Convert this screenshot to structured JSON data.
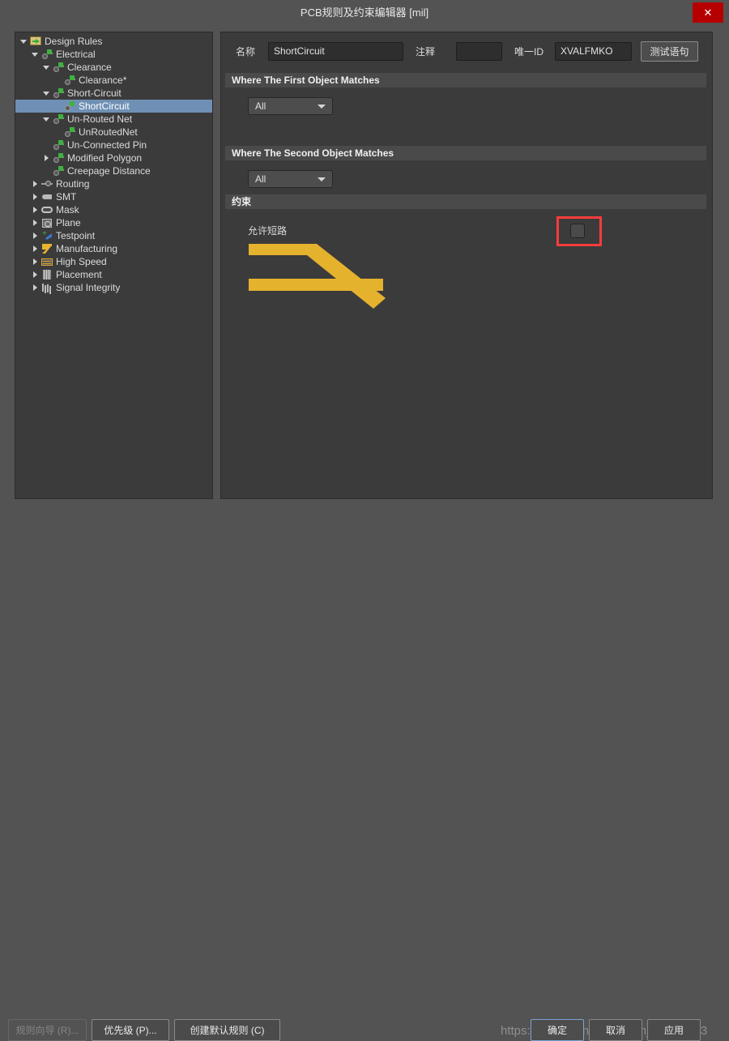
{
  "window": {
    "title": "PCB规则及约束编辑器 [mil]",
    "close_icon": "close-icon",
    "close_label": "✕"
  },
  "tree": {
    "items": [
      {
        "label": "Design Rules",
        "indent": 0,
        "twisty": "down",
        "icon": "folder-icon",
        "selected": false
      },
      {
        "label": "Electrical",
        "indent": 1,
        "twisty": "down",
        "icon": "electrical-icon",
        "selected": false
      },
      {
        "label": "Clearance",
        "indent": 2,
        "twisty": "down",
        "icon": "electrical-icon",
        "selected": false
      },
      {
        "label": "Clearance*",
        "indent": 3,
        "twisty": "none",
        "icon": "electrical-icon",
        "selected": false
      },
      {
        "label": "Short-Circuit",
        "indent": 2,
        "twisty": "down",
        "icon": "electrical-icon",
        "selected": false
      },
      {
        "label": "ShortCircuit",
        "indent": 3,
        "twisty": "none",
        "icon": "electrical-icon",
        "selected": true
      },
      {
        "label": "Un-Routed Net",
        "indent": 2,
        "twisty": "down",
        "icon": "electrical-icon",
        "selected": false
      },
      {
        "label": "UnRoutedNet",
        "indent": 3,
        "twisty": "none",
        "icon": "electrical-icon",
        "selected": false
      },
      {
        "label": "Un-Connected Pin",
        "indent": 2,
        "twisty": "none",
        "icon": "electrical-icon",
        "selected": false
      },
      {
        "label": "Modified Polygon",
        "indent": 2,
        "twisty": "right",
        "icon": "electrical-icon",
        "selected": false
      },
      {
        "label": "Creepage Distance",
        "indent": 2,
        "twisty": "none",
        "icon": "electrical-icon",
        "selected": false
      },
      {
        "label": "Routing",
        "indent": 1,
        "twisty": "right",
        "icon": "routing-icon",
        "selected": false
      },
      {
        "label": "SMT",
        "indent": 1,
        "twisty": "right",
        "icon": "smt-icon",
        "selected": false
      },
      {
        "label": "Mask",
        "indent": 1,
        "twisty": "right",
        "icon": "mask-icon",
        "selected": false
      },
      {
        "label": "Plane",
        "indent": 1,
        "twisty": "right",
        "icon": "plane-icon",
        "selected": false
      },
      {
        "label": "Testpoint",
        "indent": 1,
        "twisty": "right",
        "icon": "testpoint-icon",
        "selected": false
      },
      {
        "label": "Manufacturing",
        "indent": 1,
        "twisty": "right",
        "icon": "manufacturing-icon",
        "selected": false
      },
      {
        "label": "High Speed",
        "indent": 1,
        "twisty": "right",
        "icon": "highspeed-icon",
        "selected": false
      },
      {
        "label": "Placement",
        "indent": 1,
        "twisty": "right",
        "icon": "placement-icon",
        "selected": false
      },
      {
        "label": "Signal Integrity",
        "indent": 1,
        "twisty": "right",
        "icon": "signalintegrity-icon",
        "selected": false
      }
    ]
  },
  "form": {
    "name_label": "名称",
    "name_value": "ShortCircuit",
    "comment_label": "注释",
    "comment_value": "",
    "uid_label": "唯一ID",
    "uid_value": "XVALFMKO",
    "test_button": "测试语句"
  },
  "sections": {
    "first_object": "Where The First Object Matches",
    "second_object": "Where The Second Object Matches",
    "constraint": "约束"
  },
  "dropdowns": {
    "first_scope": "All",
    "second_scope": "All",
    "arrow_icon": "chevron-down-icon"
  },
  "constraint": {
    "allow_short_label": "允许短路",
    "checkbox_checked": false,
    "highlight_color": "#fa3c3c",
    "trace_color": "#e5b22e"
  },
  "footer": {
    "wizard_button": "规则向导 (R)...",
    "wizard_disabled": true,
    "priority_button": "优先级 (P)...",
    "default_button": "创建默认规则 (C)",
    "ok_button": "确定",
    "cancel_button": "取消",
    "apply_button": "应用"
  },
  "watermark": {
    "text": "https://blog.csdn.net/weixin_40376143"
  }
}
